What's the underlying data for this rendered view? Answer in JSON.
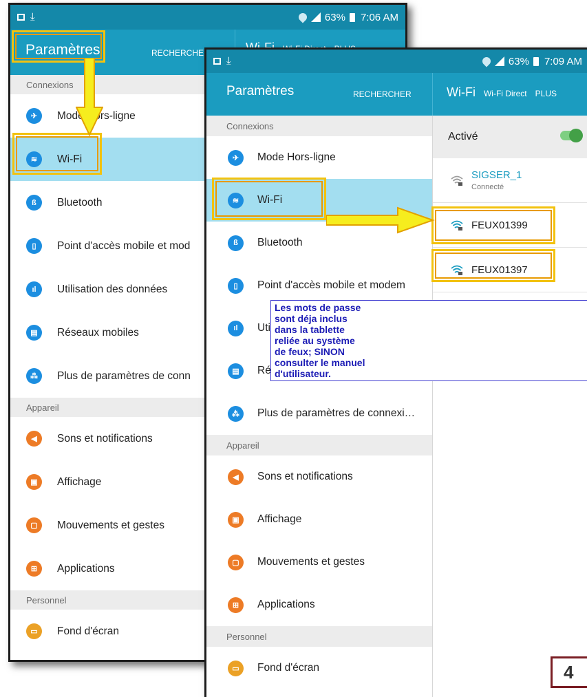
{
  "screens": [
    {
      "status_time": "7:06 AM",
      "battery": "63%",
      "header": {
        "title": "Paramètres",
        "search": "RECHERCHER",
        "wifi": "Wi-Fi",
        "wifi_direct": "Wi-Fi Direct",
        "more": "PLUS"
      },
      "sections": [
        {
          "title": "Connexions",
          "items": [
            {
              "label": "Mode Hors-ligne",
              "icon": "airplane-icon"
            },
            {
              "label": "Wi-Fi",
              "icon": "wifi-icon",
              "selected": true
            },
            {
              "label": "Bluetooth",
              "icon": "bluetooth-icon"
            },
            {
              "label": "Point d'accès mobile et mod",
              "icon": "hotspot-icon"
            },
            {
              "label": "Utilisation des données",
              "icon": "data-usage-icon"
            },
            {
              "label": "Réseaux mobiles",
              "icon": "mobile-networks-icon"
            },
            {
              "label": "Plus de paramètres de conn",
              "icon": "more-connections-icon"
            }
          ]
        },
        {
          "title": "Appareil",
          "items": [
            {
              "label": "Sons et notifications",
              "icon": "sound-icon"
            },
            {
              "label": "Affichage",
              "icon": "display-icon"
            },
            {
              "label": "Mouvements et gestes",
              "icon": "motion-icon"
            },
            {
              "label": "Applications",
              "icon": "apps-icon"
            }
          ]
        },
        {
          "title": "Personnel",
          "items": [
            {
              "label": "Fond d'écran",
              "icon": "wallpaper-icon"
            }
          ]
        }
      ]
    },
    {
      "status_time": "7:09 AM",
      "battery": "63%",
      "header": {
        "title": "Paramètres",
        "search": "RECHERCHER",
        "wifi": "Wi-Fi",
        "wifi_direct": "Wi-Fi Direct",
        "more": "PLUS"
      },
      "sections": [
        {
          "title": "Connexions",
          "items": [
            {
              "label": "Mode Hors-ligne",
              "icon": "airplane-icon"
            },
            {
              "label": "Wi-Fi",
              "icon": "wifi-icon",
              "selected": true
            },
            {
              "label": "Bluetooth",
              "icon": "bluetooth-icon"
            },
            {
              "label": "Point d'accès mobile et modem",
              "icon": "hotspot-icon"
            },
            {
              "label": "Utilisation des données",
              "icon": "data-usage-icon"
            },
            {
              "label": "Réseaux mobiles",
              "icon": "mobile-networks-icon"
            },
            {
              "label": "Plus de paramètres de connexi…",
              "icon": "more-connections-icon"
            }
          ]
        },
        {
          "title": "Appareil",
          "items": [
            {
              "label": "Sons et notifications",
              "icon": "sound-icon"
            },
            {
              "label": "Affichage",
              "icon": "display-icon"
            },
            {
              "label": "Mouvements et gestes",
              "icon": "motion-icon"
            },
            {
              "label": "Applications",
              "icon": "apps-icon"
            }
          ]
        },
        {
          "title": "Personnel",
          "items": [
            {
              "label": "Fond d'écran",
              "icon": "wallpaper-icon"
            }
          ]
        }
      ],
      "wifi_panel": {
        "toggle_label": "Activé",
        "toggle_on": true,
        "networks": [
          {
            "name": "SIGSER_1",
            "status": "Connecté"
          },
          {
            "name": "FEUX01399",
            "status": ""
          },
          {
            "name": "FEUX01397",
            "status": ""
          }
        ]
      }
    }
  ],
  "note": [
    "Les mots de passe",
    "sont déja inclus",
    "dans la tablette",
    "reliée au système",
    "de feux; SINON",
    "consulter le manuel",
    "d'utilisateur."
  ],
  "page_number": "4",
  "colors": {
    "header": "#1b9cc0",
    "status_bar": "#1488a9",
    "selected": "#a3def0",
    "highlight": "#f2c20f",
    "note_text": "#1b1bb5"
  }
}
